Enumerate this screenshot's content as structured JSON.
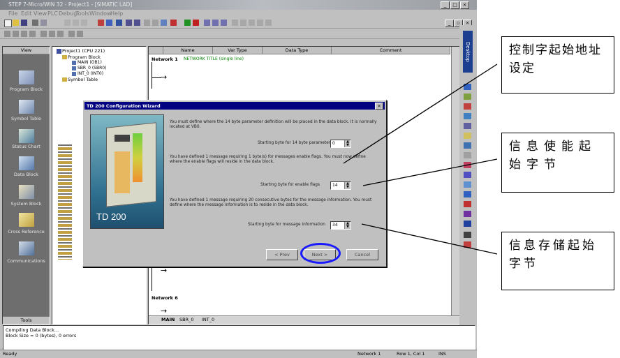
{
  "window": {
    "title": "STEP 7-Micro/WIN 32 - Project1 - [SIMATIC LAD]",
    "menu": [
      "File",
      "Edit",
      "View",
      "PLC",
      "Debug",
      "Tools",
      "Window",
      "Help"
    ]
  },
  "navbar": {
    "header": "View",
    "items": [
      {
        "label": "Program Block",
        "icon": "program-block-icon"
      },
      {
        "label": "Symbol Table",
        "icon": "symbol-table-icon"
      },
      {
        "label": "Status Chart",
        "icon": "status-chart-icon"
      },
      {
        "label": "Data Block",
        "icon": "data-block-icon"
      },
      {
        "label": "System Block",
        "icon": "system-block-icon"
      },
      {
        "label": "Cross Reference",
        "icon": "cross-reference-icon"
      },
      {
        "label": "Communications",
        "icon": "communications-icon"
      }
    ],
    "footer": "Tools"
  },
  "tree": {
    "project": "Project1 (CPU 221)",
    "program_block": "Program Block",
    "items": [
      "MAIN (OB1)",
      "SBR_0 (SBR0)",
      "INT_0 (INT0)"
    ],
    "symbol_table": "Symbol Table"
  },
  "editor": {
    "columns": [
      "Name",
      "Var Type",
      "Data Type",
      "Comment"
    ],
    "network1": "Network 1",
    "network1_title": "NETWORK TITLE (single line)",
    "network6": "Network 6",
    "tabs": [
      "MAIN",
      "SBR_0",
      "INT_0"
    ]
  },
  "dialog": {
    "title": "TD 200 Configuration Wizard",
    "image_label": "TD 200",
    "para1": "You must define where the 14 byte parameter definition will be placed in the data block. It is normally located at VB0.",
    "field1_label": "Starting byte for 14 byte parameter block",
    "field1_value": "0",
    "para2": "You have defined 1 message requiring 1 byte(s) for messages enable flags. You must now define where the enable flags will reside in the data block.",
    "field2_label": "Starting byte for enable flags",
    "field2_value": "14",
    "para3": "You have defined 1 message requiring 20 consecutive bytes for the message information. You must define where the message information is to reside in the data block.",
    "field3_label": "Starting byte for message information",
    "field3_value": "34",
    "prev": "< Prev",
    "next": "Next >",
    "cancel": "Cancel"
  },
  "output": {
    "line1": "Compiling Data Block...",
    "line2": "Block Size = 0 (bytes), 0 errors"
  },
  "status": {
    "ready": "Ready",
    "network": "Network 1",
    "rowcol": "Row 1, Col 1",
    "ins": "INS"
  },
  "dock": {
    "label": "Desktop"
  },
  "callouts": {
    "c1": "控制字起始地址设定",
    "c2": "信息使能起始字节",
    "c3": "信息存储起始字节"
  },
  "colors": {
    "dialog_title": "#000080",
    "highlight_circle": "#1a1aff",
    "nav_bg": "#6e6e6e"
  }
}
